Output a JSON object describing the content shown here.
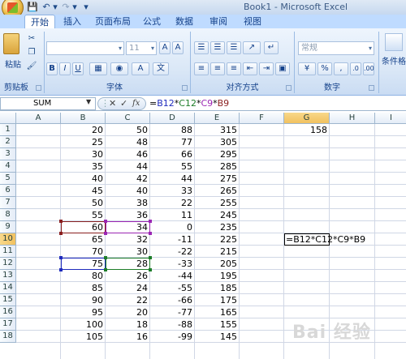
{
  "window": {
    "title": "Book1 - Microsoft Excel"
  },
  "tabs": [
    "开始",
    "插入",
    "页面布局",
    "公式",
    "数据",
    "审阅",
    "视图"
  ],
  "active_tab": "开始",
  "ribbon": {
    "clipboard": {
      "paste_label": "粘贴",
      "group_label": "剪贴板"
    },
    "font": {
      "font_size": "11",
      "group_label": "字体"
    },
    "alignment": {
      "group_label": "对齐方式"
    },
    "number": {
      "format": "常规",
      "group_label": "数字"
    },
    "styles": {
      "cond_format_label": "条件格"
    }
  },
  "formula_bar": {
    "name_box": "SUM",
    "fx_label": "fx",
    "formula_parts": [
      "=",
      "B12",
      "*",
      "C12",
      "*",
      "C9",
      "*",
      "B9"
    ]
  },
  "grid": {
    "columns": [
      "A",
      "B",
      "C",
      "D",
      "E",
      "F",
      "G",
      "H",
      "I"
    ],
    "selected_column": "G",
    "selected_row": "10",
    "rows": [
      {
        "r": "1",
        "B": "20",
        "C": "50",
        "D": "88",
        "E": "315",
        "G": "158"
      },
      {
        "r": "2",
        "B": "25",
        "C": "48",
        "D": "77",
        "E": "305"
      },
      {
        "r": "3",
        "B": "30",
        "C": "46",
        "D": "66",
        "E": "295"
      },
      {
        "r": "4",
        "B": "35",
        "C": "44",
        "D": "55",
        "E": "285"
      },
      {
        "r": "5",
        "B": "40",
        "C": "42",
        "D": "44",
        "E": "275"
      },
      {
        "r": "6",
        "B": "45",
        "C": "40",
        "D": "33",
        "E": "265"
      },
      {
        "r": "7",
        "B": "50",
        "C": "38",
        "D": "22",
        "E": "255"
      },
      {
        "r": "8",
        "B": "55",
        "C": "36",
        "D": "11",
        "E": "245"
      },
      {
        "r": "9",
        "B": "60",
        "C": "34",
        "D": "0",
        "E": "235"
      },
      {
        "r": "10",
        "B": "65",
        "C": "32",
        "D": "-11",
        "E": "225"
      },
      {
        "r": "11",
        "B": "70",
        "C": "30",
        "D": "-22",
        "E": "215"
      },
      {
        "r": "12",
        "B": "75",
        "C": "28",
        "D": "-33",
        "E": "205"
      },
      {
        "r": "13",
        "B": "80",
        "C": "26",
        "D": "-44",
        "E": "195"
      },
      {
        "r": "14",
        "B": "85",
        "C": "24",
        "D": "-55",
        "E": "185"
      },
      {
        "r": "15",
        "B": "90",
        "C": "22",
        "D": "-66",
        "E": "175"
      },
      {
        "r": "16",
        "B": "95",
        "C": "20",
        "D": "-77",
        "E": "165"
      },
      {
        "r": "17",
        "B": "100",
        "C": "18",
        "D": "-88",
        "E": "155"
      },
      {
        "r": "18",
        "B": "105",
        "C": "16",
        "D": "-99",
        "E": "145"
      }
    ],
    "editing_cell_text": "=B12*C12*C9*B9"
  },
  "colors": {
    "ref_b12": "#1f2bbd",
    "ref_c12": "#1d7d28",
    "ref_c9": "#9b25b3",
    "ref_b9": "#8a1f1f"
  },
  "watermark": "Bai 经验"
}
